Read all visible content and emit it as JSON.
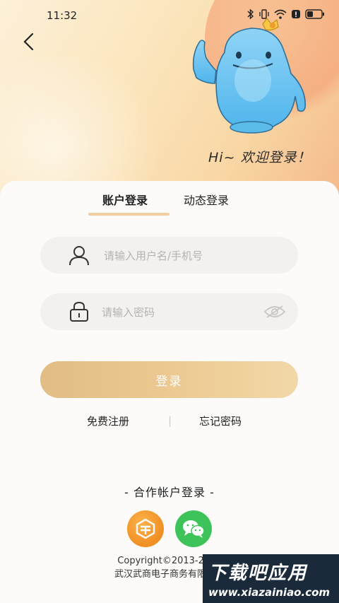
{
  "status_bar": {
    "time": "11:32"
  },
  "greeting": "Hi~ 欢迎登录！",
  "tabs": [
    {
      "label": "账户登录",
      "active": true
    },
    {
      "label": "动态登录",
      "active": false
    }
  ],
  "form": {
    "username_placeholder": "请输入用户名/手机号",
    "password_placeholder": "请输入密码",
    "login_label": "登录"
  },
  "links": {
    "register": "免费注册",
    "divider": "|",
    "forgot": "忘记密码"
  },
  "partner": {
    "title": "- 合作帐户登录 -"
  },
  "copyright": {
    "line1": "Copyright©2013-2023",
    "line2": "武汉武商电子商务有限公司"
  },
  "watermark": {
    "title": "下载吧应用",
    "url": "www.xiazainiao.com"
  },
  "colors": {
    "accent": "#e8c58c",
    "tab_indicator": "#f2cf9c",
    "wechat": "#3ec35b",
    "partner_orange": "#f39a2b"
  }
}
